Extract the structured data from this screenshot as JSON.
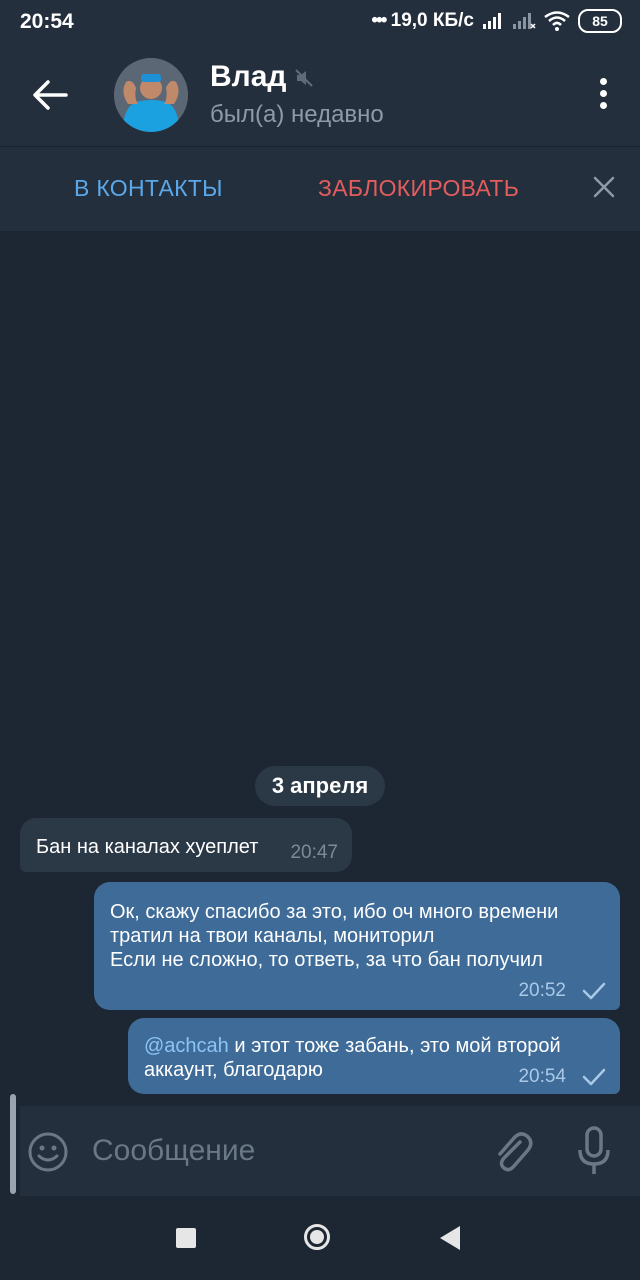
{
  "statusbar": {
    "time": "20:54",
    "network_speed": "19,0 КБ/с",
    "battery": "85"
  },
  "chat": {
    "name": "Влад",
    "status": "был(а) недавно"
  },
  "actions": {
    "add_contact": "В КОНТАКТЫ",
    "block": "ЗАБЛОКИРОВАТЬ"
  },
  "date_label": "3 апреля",
  "messages": [
    {
      "direction": "in",
      "text": "Бан на каналах хуеплет",
      "time": "20:47"
    },
    {
      "direction": "out",
      "lines": [
        "Ок, скажу спасибо за это, ибо оч много времени",
        "тратил на твои каналы, мониторил",
        "Если не сложно, то ответь, за что бан получил"
      ],
      "time": "20:52"
    },
    {
      "direction": "out",
      "mention": "@achcah",
      "line1_rest": " и этот тоже забань, это мой второй",
      "line2": "аккаунт, благодарю",
      "time": "20:54"
    }
  ],
  "input": {
    "placeholder": "Сообщение"
  },
  "icons": [
    "back-arrow-icon",
    "mute-icon",
    "more-vert-icon",
    "close-icon",
    "emoji-icon",
    "attach-icon",
    "mic-icon",
    "check-icon"
  ]
}
